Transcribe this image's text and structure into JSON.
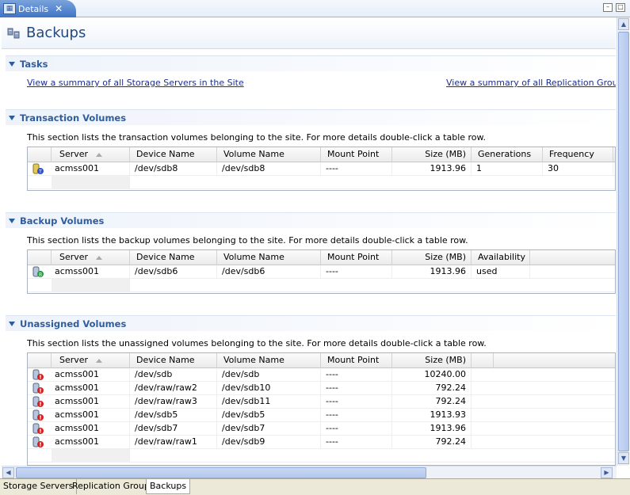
{
  "editor_tab": {
    "label": "Details",
    "close": "✕"
  },
  "window_controls": {
    "minimize": "–",
    "maximize": "□"
  },
  "page": {
    "title": "Backups"
  },
  "tasks": {
    "title": "Tasks",
    "link_storage": "View a summary of all Storage Servers in the Site",
    "link_replication": "View a summary of all Replication Groups in t"
  },
  "transaction": {
    "title": "Transaction Volumes",
    "description": "This section lists the transaction volumes belonging to the site. For more details double-click a table row.",
    "columns": [
      "Server",
      "Device Name",
      "Volume Name",
      "Mount Point",
      "Size (MB)",
      "Generations",
      "Frequency"
    ],
    "rows": [
      {
        "server": "acmss001",
        "device": "/dev/sdb8",
        "volume": "/dev/sdb8",
        "mount": "----",
        "size": "1913.96",
        "generations": "1",
        "frequency": "30"
      }
    ]
  },
  "backup": {
    "title": "Backup Volumes",
    "description": "This section lists the backup volumes belonging to the site. For more details double-click a table row.",
    "columns": [
      "Server",
      "Device Name",
      "Volume Name",
      "Mount Point",
      "Size (MB)",
      "Availability"
    ],
    "rows": [
      {
        "server": "acmss001",
        "device": "/dev/sdb6",
        "volume": "/dev/sdb6",
        "mount": "----",
        "size": "1913.96",
        "availability": "used"
      }
    ]
  },
  "unassigned": {
    "title": "Unassigned Volumes",
    "description": "This section lists the unassigned volumes belonging to the site. For more details double-click a table row.",
    "columns": [
      "Server",
      "Device Name",
      "Volume Name",
      "Mount Point",
      "Size (MB)"
    ],
    "rows": [
      {
        "server": "acmss001",
        "device": "/dev/sdb",
        "volume": "/dev/sdb",
        "mount": "----",
        "size": "10240.00"
      },
      {
        "server": "acmss001",
        "device": "/dev/raw/raw2",
        "volume": "/dev/sdb10",
        "mount": "----",
        "size": "792.24"
      },
      {
        "server": "acmss001",
        "device": "/dev/raw/raw3",
        "volume": "/dev/sdb11",
        "mount": "----",
        "size": "792.24"
      },
      {
        "server": "acmss001",
        "device": "/dev/sdb5",
        "volume": "/dev/sdb5",
        "mount": "----",
        "size": "1913.93"
      },
      {
        "server": "acmss001",
        "device": "/dev/sdb7",
        "volume": "/dev/sdb7",
        "mount": "----",
        "size": "1913.96"
      },
      {
        "server": "acmss001",
        "device": "/dev/raw/raw1",
        "volume": "/dev/sdb9",
        "mount": "----",
        "size": "792.24"
      }
    ]
  },
  "bottom_tabs": [
    "Storage Servers",
    "Replication Groups",
    "Backups"
  ],
  "scroll_glyphs": {
    "up": "▲",
    "down": "▼",
    "left": "◀",
    "right": "▶"
  },
  "colors": {
    "transaction_badge": "#2f4fd0",
    "backup_badge": "#1e9e3a",
    "unassigned_badge": "#d42020"
  }
}
